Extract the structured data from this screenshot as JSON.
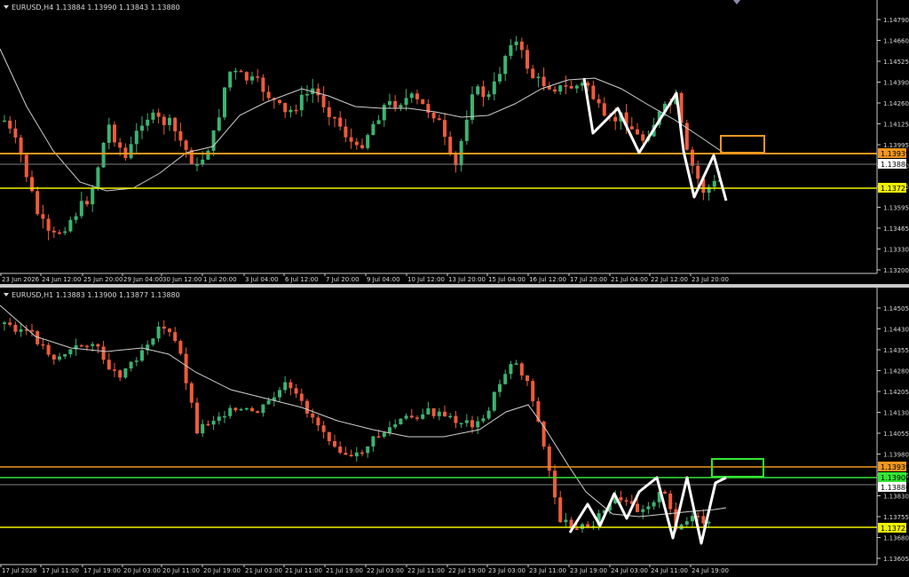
{
  "colors": {
    "background": "#000000",
    "bull": "#3cb371",
    "bear": "#ef5b3c",
    "ma": "#cfcfcf",
    "orange": "#f0961e",
    "yellow": "#f0f000",
    "green": "#32e632",
    "grid_text": "#d8d8d8",
    "current": "#b4b4b4"
  },
  "top": {
    "header": "EURUSD,H4  1.13884 1.13990 1.13843 1.13880",
    "price_labels": [
      "1.14790",
      "1.14660",
      "1.14525",
      "1.14390",
      "1.14260",
      "1.14125",
      "1.13995",
      "1.13860",
      "1.13725",
      "1.13595",
      "1.13465",
      "1.13330",
      "1.13200"
    ],
    "time_labels": [
      "23 Jun 2026",
      "24 Jun 12:00",
      "25 Jun 20:00",
      "29 Jun 04:00",
      "30 Jun 12:00",
      "1 Jul 20:00",
      "3 Jul 04:00",
      "6 Jul 12:00",
      "7 Jul 20:00",
      "9 Jul 04:00",
      "10 Jul 12:00",
      "13 Jul 20:00",
      "15 Jul 04:00",
      "16 Jul 12:00",
      "17 Jul 20:00",
      "21 Jul 04:00",
      "22 Jul 12:00",
      "23 Jul 20:00"
    ],
    "tag_orange": "1.13939",
    "tag_current": "1.13880",
    "tag_yellow": "1.13725"
  },
  "bottom": {
    "header": "EURUSD,H1  1.13883 1.13900 1.13877 1.13880",
    "price_labels": [
      "1.14505",
      "1.14430",
      "1.14355",
      "1.14280",
      "1.14205",
      "1.14130",
      "1.14055",
      "1.13980",
      "1.13905",
      "1.13830",
      "1.13755",
      "1.13680",
      "1.13605"
    ],
    "time_labels": [
      "17 Jul 2026",
      "17 Jul 11:00",
      "17 Jul 19:00",
      "20 Jul 03:00",
      "20 Jul 11:00",
      "20 Jul 19:00",
      "21 Jul 03:00",
      "21 Jul 11:00",
      "21 Jul 19:00",
      "22 Jul 03:00",
      "22 Jul 11:00",
      "22 Jul 19:00",
      "23 Jul 03:00",
      "23 Jul 11:00",
      "23 Jul 19:00",
      "24 Jul 03:00",
      "24 Jul 11:00",
      "24 Jul 19:00"
    ],
    "tag_orange": "1.13939",
    "tag_green": "1.13900",
    "tag_current": "1.13880",
    "tag_yellow": "1.13725"
  }
}
